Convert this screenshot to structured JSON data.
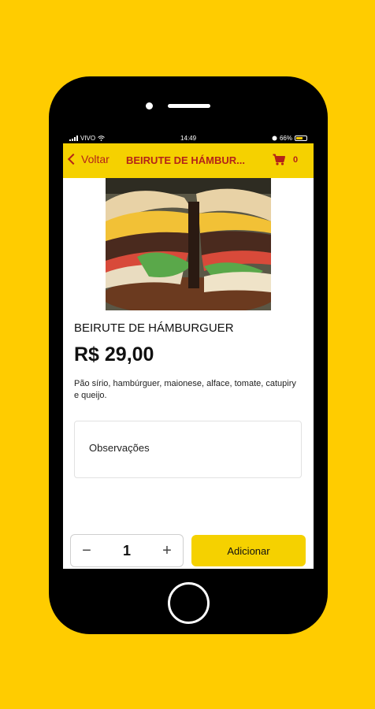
{
  "status_bar": {
    "carrier": "VIVO",
    "time": "14:49",
    "battery": "66%",
    "battery_level": 0.66
  },
  "nav": {
    "back_label": "Voltar",
    "title": "BEIRUTE DE HÁMBUR...",
    "cart_count": "0",
    "icons": {
      "back": "chevron-left-icon",
      "cart": "cart-icon"
    }
  },
  "product": {
    "name": "BEIRUTE DE HÁMBURGUER",
    "price": "R$ 29,00",
    "description": "Pão sírio, hambúrguer, maionese, alface, tomate, catupiry e queijo.",
    "image_icon": "expand-icon"
  },
  "observations": {
    "placeholder": "Observações"
  },
  "order": {
    "minus_label": "−",
    "quantity": "1",
    "plus_label": "+",
    "add_label": "Adicionar"
  },
  "colors": {
    "background": "#FFCC00",
    "nav_bar": "#F5D100",
    "accent_red": "#B42318",
    "add_button": "#F5D100"
  }
}
